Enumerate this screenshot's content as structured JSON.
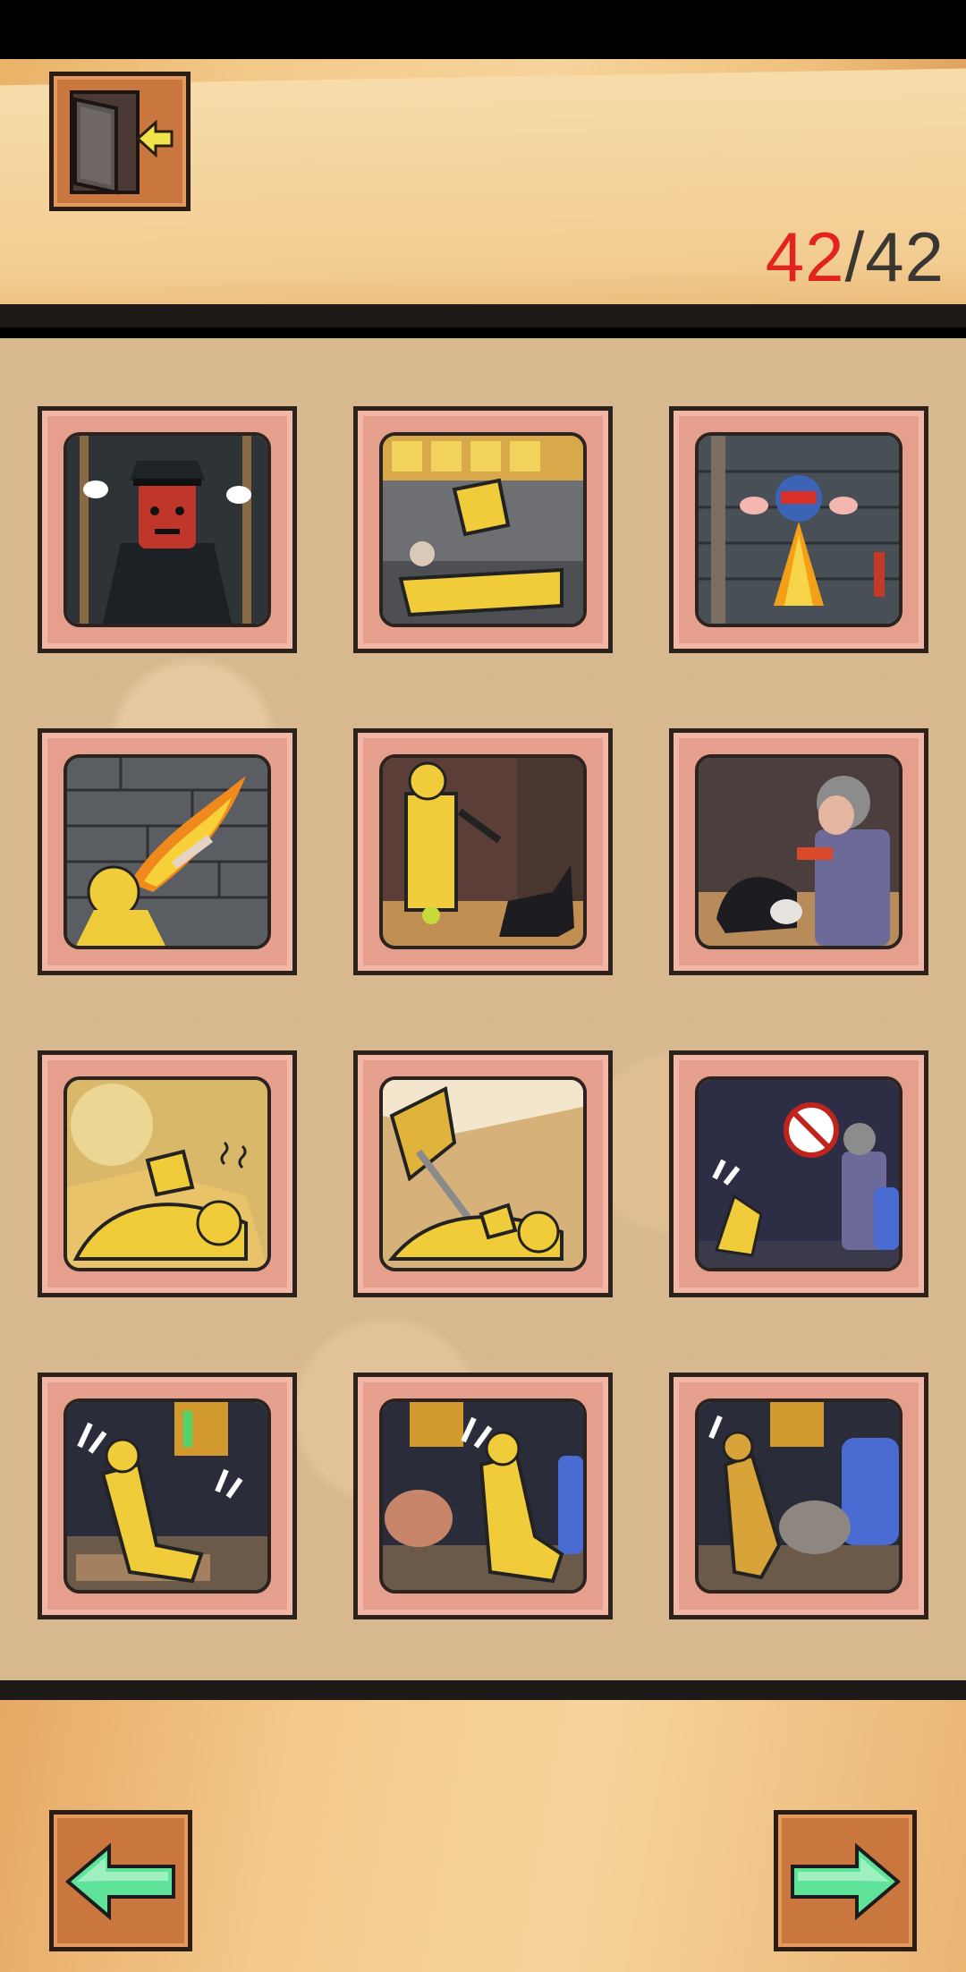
{
  "header": {
    "exit_button": {
      "icon": "exit-door-icon"
    },
    "counter": {
      "current": "42",
      "separator": "/",
      "total": "42"
    }
  },
  "gallery": {
    "cards": [
      {
        "scene": "angry-police-officer"
      },
      {
        "scene": "yellow-raincoat-fall"
      },
      {
        "scene": "masked-hero-fire"
      },
      {
        "scene": "fire-breath-wall"
      },
      {
        "scene": "raincoat-dog-ball"
      },
      {
        "scene": "old-woman-dog"
      },
      {
        "scene": "crash-dazed-yellow"
      },
      {
        "scene": "crash-dazed-yellow-2"
      },
      {
        "scene": "no-sign-old-woman"
      },
      {
        "scene": "scooter-alarm-1"
      },
      {
        "scene": "scooter-alarm-2"
      },
      {
        "scene": "scooter-alarm-3"
      }
    ]
  },
  "footer": {
    "prev_button": {
      "icon": "arrow-left-icon"
    },
    "next_button": {
      "icon": "arrow-right-icon"
    }
  },
  "colors": {
    "counter_current": "#e2241f",
    "counter_total": "#3a3733",
    "card_frame": "#e69f8c",
    "arrow": "#5fe39a"
  }
}
